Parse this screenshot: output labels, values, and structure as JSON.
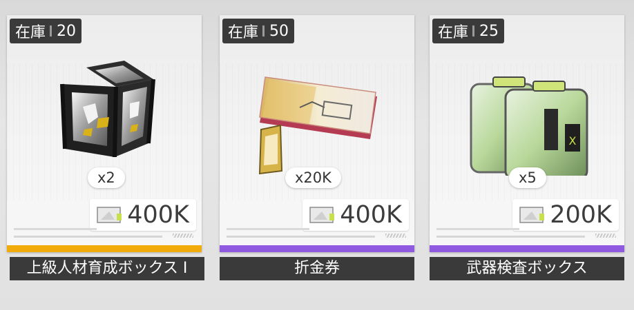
{
  "colors": {
    "card_panel": "#3a3a3a",
    "rarity_gold": "#f1ac0b",
    "rarity_purple": "#8f5ae0"
  },
  "items": [
    {
      "stock_label": "在庫",
      "stock": "20",
      "quantity": "x2",
      "price": "400K",
      "name": "上級人材育成ボックス Ⅰ",
      "rarity_color": "#f1ac0b",
      "icon": "advanced-box-icon"
    },
    {
      "stock_label": "在庫",
      "stock": "50",
      "quantity": "x20K",
      "price": "400K",
      "name": "折金券",
      "rarity_color": "#8f5ae0",
      "icon": "coupon-icon"
    },
    {
      "stock_label": "在庫",
      "stock": "25",
      "quantity": "x5",
      "price": "200K",
      "name": "武器検査ボックス",
      "rarity_color": "#8f5ae0",
      "icon": "weapon-box-icon"
    }
  ],
  "currency_icon": "currency-ticket-icon"
}
